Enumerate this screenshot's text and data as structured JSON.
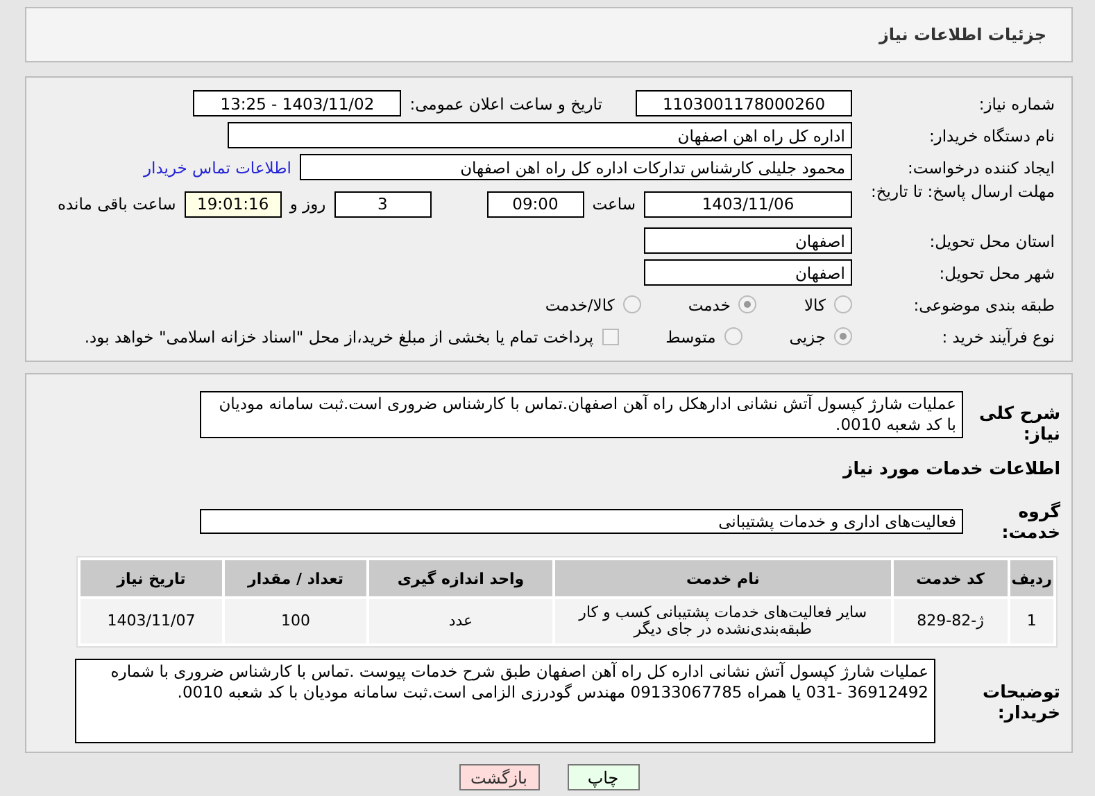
{
  "header": {
    "title": "جزئیات اطلاعات نیاز"
  },
  "need_number": {
    "label": "شماره نیاز:",
    "value": "1103001178000260"
  },
  "announce": {
    "label": "تاریخ و ساعت اعلان عمومی:",
    "value": "1403/11/02 - 13:25"
  },
  "buyer_org": {
    "label": "نام دستگاه خریدار:",
    "value": "اداره کل راه اهن اصفهان"
  },
  "creator": {
    "label": "ایجاد کننده درخواست:",
    "value": "محمود جلیلی کارشناس تدارکات اداره کل راه اهن اصفهان",
    "link": "اطلاعات تماس خریدار"
  },
  "deadline": {
    "label": "مهلت ارسال پاسخ: تا تاریخ:",
    "date": "1403/11/06",
    "time_label": "ساعت",
    "time": "09:00",
    "days": "3",
    "days_label": "روز و",
    "remaining": "19:01:16",
    "remaining_label": "ساعت باقی مانده"
  },
  "province": {
    "label": "استان محل تحویل:",
    "value": "اصفهان"
  },
  "city": {
    "label": "شهر محل تحویل:",
    "value": "اصفهان"
  },
  "category": {
    "label": "طبقه بندی موضوعی:",
    "options": [
      {
        "label": "کالا",
        "selected": false
      },
      {
        "label": "خدمت",
        "selected": true
      },
      {
        "label": "کالا/خدمت",
        "selected": false
      }
    ]
  },
  "process": {
    "label": "نوع فرآیند خرید :",
    "options": [
      {
        "label": "جزیی",
        "selected": true
      },
      {
        "label": "متوسط",
        "selected": false
      }
    ],
    "checkbox": {
      "label": "پرداخت تمام یا بخشی از مبلغ خرید،از محل \"اسناد خزانه اسلامی\" خواهد بود.",
      "checked": false
    }
  },
  "description": {
    "label": "شرح کلی نیاز:",
    "value": "عملیات شارژ کپسول آتش نشانی ادارهکل راه آهن اصفهان.تماس با کارشناس ضروری است.ثبت سامانه مودیان با کد شعبه 0010."
  },
  "services_title": "اطلاعات خدمات مورد نیاز",
  "service_group": {
    "label": "گروه خدمت:",
    "value": "فعالیت‌های اداری و خدمات پشتیبانی"
  },
  "table": {
    "columns": [
      "ردیف",
      "کد خدمت",
      "نام خدمت",
      "واحد اندازه گیری",
      "تعداد / مقدار",
      "تاریخ نیاز"
    ],
    "rows": [
      [
        "1",
        "ژ-82-829",
        "سایر فعالیت‌های خدمات پشتیبانی کسب و کار طبقه‌بندی‌نشده در جای دیگر",
        "عدد",
        "100",
        "1403/11/07"
      ]
    ]
  },
  "buyer_notes": {
    "label": "توضیحات خریدار:",
    "value": "عملیات شارژ کپسول آتش نشانی اداره کل راه آهن اصفهان طبق شرح خدمات پیوست .تماس با کارشناس ضروری  با شماره 36912492 -031 یا همراه 09133067785 مهندس گودرزی الزامی است.ثبت سامانه مودیان با کد شعبه 0010."
  },
  "buttons": [
    {
      "label": "چاپ",
      "kind": "print"
    },
    {
      "label": "بازگشت",
      "kind": "back"
    }
  ]
}
